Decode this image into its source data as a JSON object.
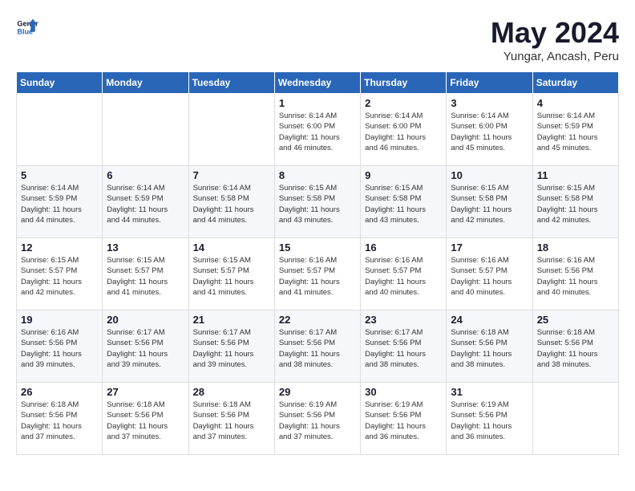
{
  "header": {
    "logo_line1": "General",
    "logo_line2": "Blue",
    "month_title": "May 2024",
    "location": "Yungar, Ancash, Peru"
  },
  "days_of_week": [
    "Sunday",
    "Monday",
    "Tuesday",
    "Wednesday",
    "Thursday",
    "Friday",
    "Saturday"
  ],
  "weeks": [
    [
      {
        "day": "",
        "text": ""
      },
      {
        "day": "",
        "text": ""
      },
      {
        "day": "",
        "text": ""
      },
      {
        "day": "1",
        "text": "Sunrise: 6:14 AM\nSunset: 6:00 PM\nDaylight: 11 hours\nand 46 minutes."
      },
      {
        "day": "2",
        "text": "Sunrise: 6:14 AM\nSunset: 6:00 PM\nDaylight: 11 hours\nand 46 minutes."
      },
      {
        "day": "3",
        "text": "Sunrise: 6:14 AM\nSunset: 6:00 PM\nDaylight: 11 hours\nand 45 minutes."
      },
      {
        "day": "4",
        "text": "Sunrise: 6:14 AM\nSunset: 5:59 PM\nDaylight: 11 hours\nand 45 minutes."
      }
    ],
    [
      {
        "day": "5",
        "text": "Sunrise: 6:14 AM\nSunset: 5:59 PM\nDaylight: 11 hours\nand 44 minutes."
      },
      {
        "day": "6",
        "text": "Sunrise: 6:14 AM\nSunset: 5:59 PM\nDaylight: 11 hours\nand 44 minutes."
      },
      {
        "day": "7",
        "text": "Sunrise: 6:14 AM\nSunset: 5:58 PM\nDaylight: 11 hours\nand 44 minutes."
      },
      {
        "day": "8",
        "text": "Sunrise: 6:15 AM\nSunset: 5:58 PM\nDaylight: 11 hours\nand 43 minutes."
      },
      {
        "day": "9",
        "text": "Sunrise: 6:15 AM\nSunset: 5:58 PM\nDaylight: 11 hours\nand 43 minutes."
      },
      {
        "day": "10",
        "text": "Sunrise: 6:15 AM\nSunset: 5:58 PM\nDaylight: 11 hours\nand 42 minutes."
      },
      {
        "day": "11",
        "text": "Sunrise: 6:15 AM\nSunset: 5:58 PM\nDaylight: 11 hours\nand 42 minutes."
      }
    ],
    [
      {
        "day": "12",
        "text": "Sunrise: 6:15 AM\nSunset: 5:57 PM\nDaylight: 11 hours\nand 42 minutes."
      },
      {
        "day": "13",
        "text": "Sunrise: 6:15 AM\nSunset: 5:57 PM\nDaylight: 11 hours\nand 41 minutes."
      },
      {
        "day": "14",
        "text": "Sunrise: 6:15 AM\nSunset: 5:57 PM\nDaylight: 11 hours\nand 41 minutes."
      },
      {
        "day": "15",
        "text": "Sunrise: 6:16 AM\nSunset: 5:57 PM\nDaylight: 11 hours\nand 41 minutes."
      },
      {
        "day": "16",
        "text": "Sunrise: 6:16 AM\nSunset: 5:57 PM\nDaylight: 11 hours\nand 40 minutes."
      },
      {
        "day": "17",
        "text": "Sunrise: 6:16 AM\nSunset: 5:57 PM\nDaylight: 11 hours\nand 40 minutes."
      },
      {
        "day": "18",
        "text": "Sunrise: 6:16 AM\nSunset: 5:56 PM\nDaylight: 11 hours\nand 40 minutes."
      }
    ],
    [
      {
        "day": "19",
        "text": "Sunrise: 6:16 AM\nSunset: 5:56 PM\nDaylight: 11 hours\nand 39 minutes."
      },
      {
        "day": "20",
        "text": "Sunrise: 6:17 AM\nSunset: 5:56 PM\nDaylight: 11 hours\nand 39 minutes."
      },
      {
        "day": "21",
        "text": "Sunrise: 6:17 AM\nSunset: 5:56 PM\nDaylight: 11 hours\nand 39 minutes."
      },
      {
        "day": "22",
        "text": "Sunrise: 6:17 AM\nSunset: 5:56 PM\nDaylight: 11 hours\nand 38 minutes."
      },
      {
        "day": "23",
        "text": "Sunrise: 6:17 AM\nSunset: 5:56 PM\nDaylight: 11 hours\nand 38 minutes."
      },
      {
        "day": "24",
        "text": "Sunrise: 6:18 AM\nSunset: 5:56 PM\nDaylight: 11 hours\nand 38 minutes."
      },
      {
        "day": "25",
        "text": "Sunrise: 6:18 AM\nSunset: 5:56 PM\nDaylight: 11 hours\nand 38 minutes."
      }
    ],
    [
      {
        "day": "26",
        "text": "Sunrise: 6:18 AM\nSunset: 5:56 PM\nDaylight: 11 hours\nand 37 minutes."
      },
      {
        "day": "27",
        "text": "Sunrise: 6:18 AM\nSunset: 5:56 PM\nDaylight: 11 hours\nand 37 minutes."
      },
      {
        "day": "28",
        "text": "Sunrise: 6:18 AM\nSunset: 5:56 PM\nDaylight: 11 hours\nand 37 minutes."
      },
      {
        "day": "29",
        "text": "Sunrise: 6:19 AM\nSunset: 5:56 PM\nDaylight: 11 hours\nand 37 minutes."
      },
      {
        "day": "30",
        "text": "Sunrise: 6:19 AM\nSunset: 5:56 PM\nDaylight: 11 hours\nand 36 minutes."
      },
      {
        "day": "31",
        "text": "Sunrise: 6:19 AM\nSunset: 5:56 PM\nDaylight: 11 hours\nand 36 minutes."
      },
      {
        "day": "",
        "text": ""
      }
    ]
  ]
}
